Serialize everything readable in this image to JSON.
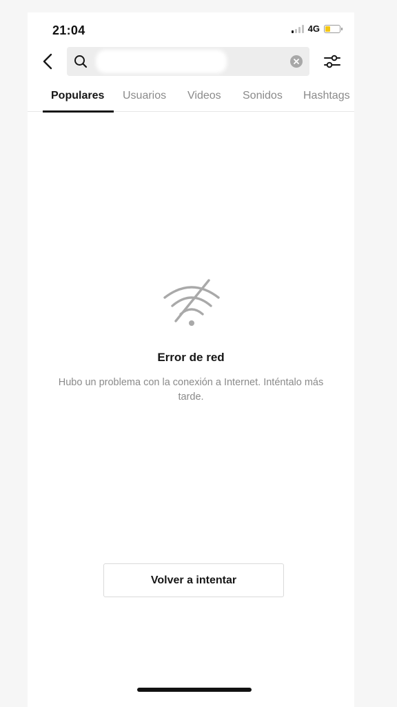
{
  "status_bar": {
    "time": "21:04",
    "network": "4G",
    "battery_level": 0.35,
    "battery_color": "#f3c613"
  },
  "header": {
    "back_icon": "chevron-left-icon",
    "search_icon": "search-icon",
    "search_value": "",
    "clear_icon": "clear-icon",
    "filter_icon": "sliders-icon"
  },
  "tabs": [
    {
      "label": "Populares",
      "active": true
    },
    {
      "label": "Usuarios",
      "active": false
    },
    {
      "label": "Videos",
      "active": false
    },
    {
      "label": "Sonidos",
      "active": false
    },
    {
      "label": "Hashtags",
      "active": false
    }
  ],
  "error": {
    "icon": "wifi-off-icon",
    "title": "Error de red",
    "message": "Hubo un problema con la conexión a Internet. Inténtalo más tarde."
  },
  "retry_button": {
    "label": "Volver a intentar"
  },
  "colors": {
    "text_primary": "#161616",
    "text_secondary": "#8a8a8a",
    "search_bg": "#ededed"
  }
}
